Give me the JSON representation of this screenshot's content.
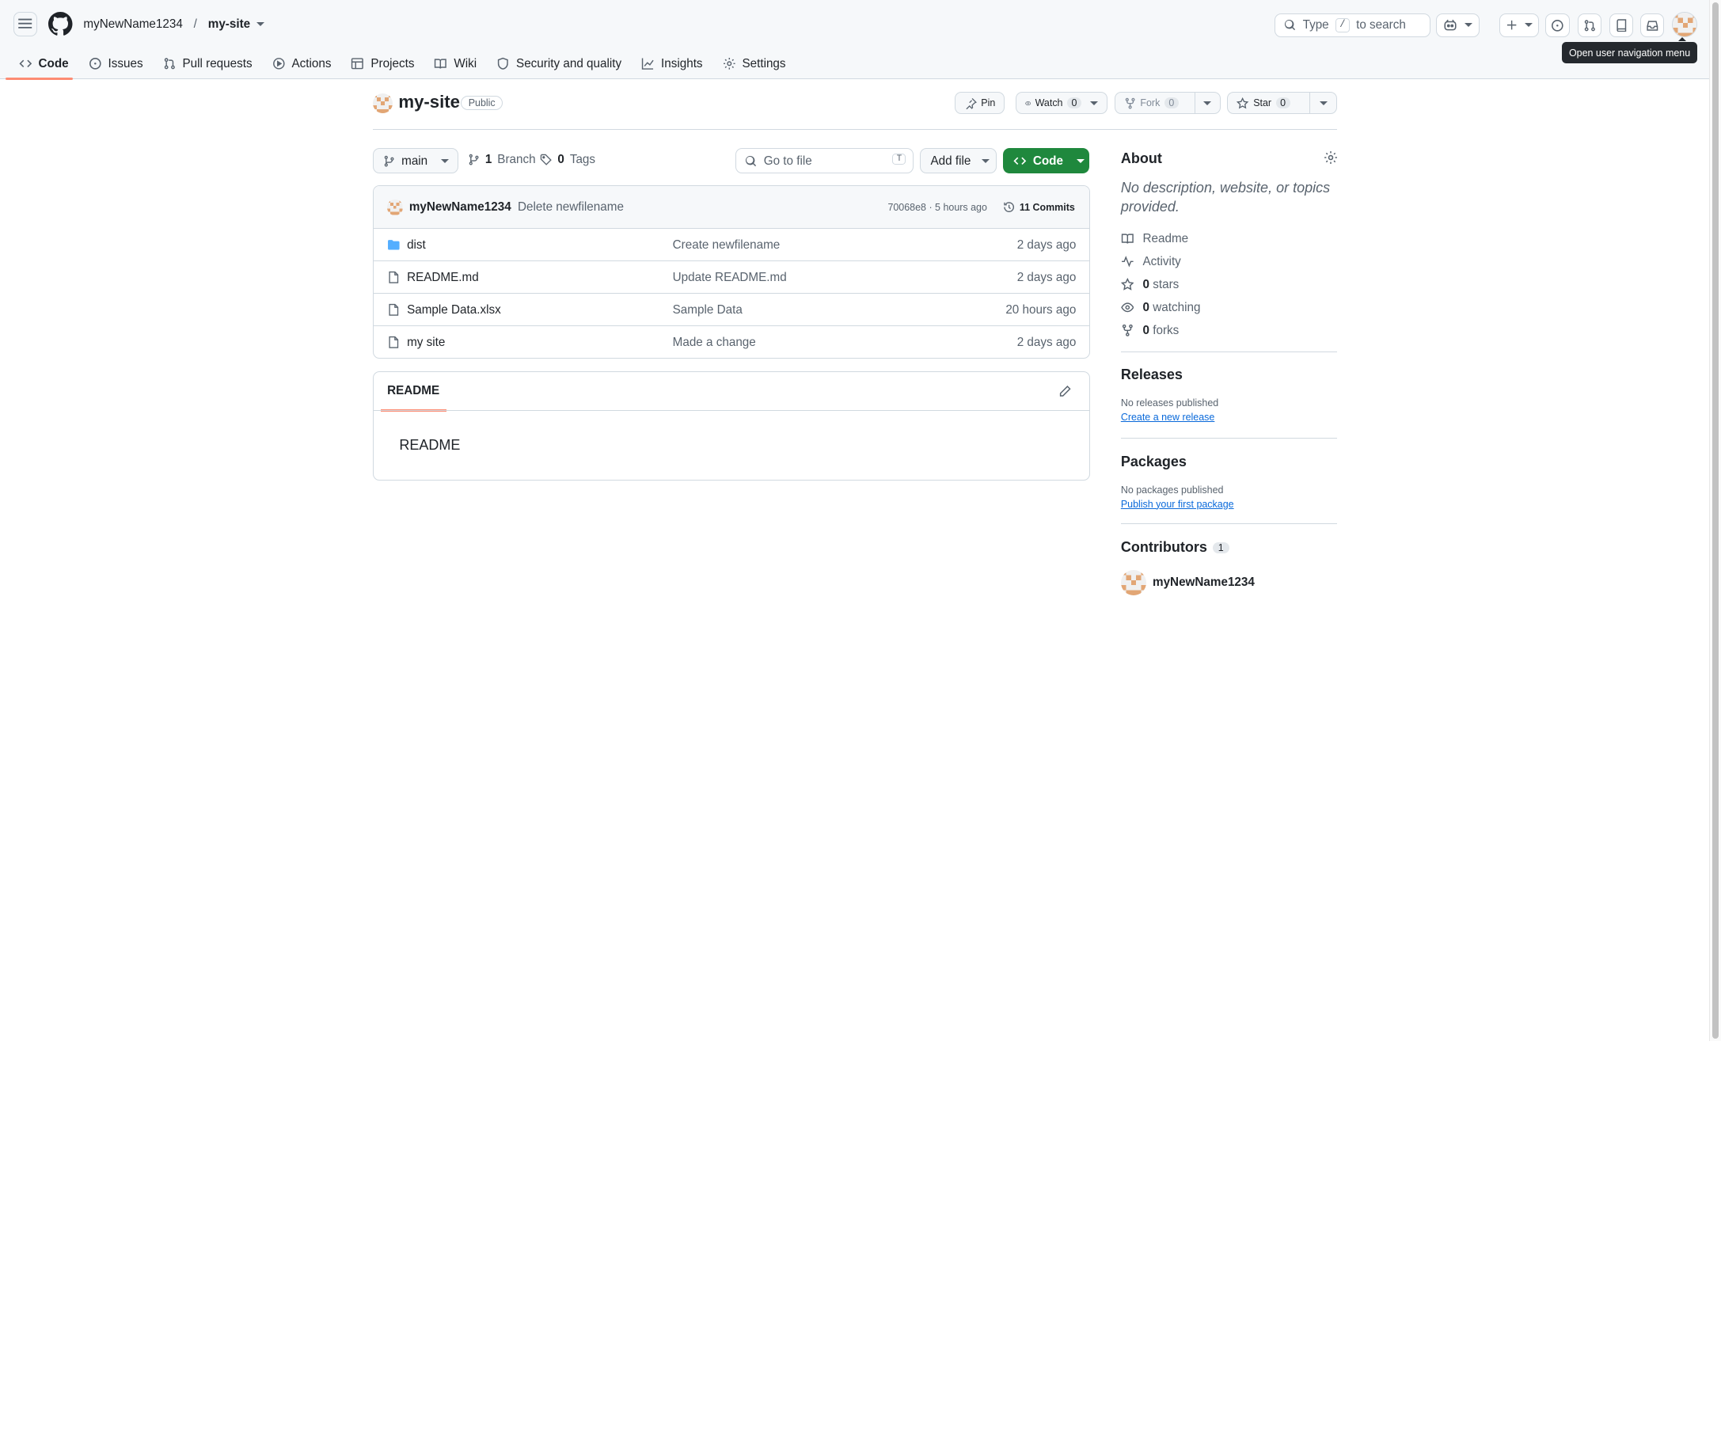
{
  "header": {
    "owner": "myNewName1234",
    "separator": "/",
    "repo": "my-site",
    "search_type": "Type",
    "search_key": "/",
    "search_rest": "to search",
    "tooltip": "Open user navigation menu"
  },
  "tabs": [
    {
      "label": "Code",
      "icon": "code-icon"
    },
    {
      "label": "Issues",
      "icon": "issue-icon"
    },
    {
      "label": "Pull requests",
      "icon": "pull-request-icon"
    },
    {
      "label": "Actions",
      "icon": "play-icon"
    },
    {
      "label": "Projects",
      "icon": "table-icon"
    },
    {
      "label": "Wiki",
      "icon": "book-icon"
    },
    {
      "label": "Security and quality",
      "icon": "shield-icon"
    },
    {
      "label": "Insights",
      "icon": "graph-icon"
    },
    {
      "label": "Settings",
      "icon": "gear-icon"
    }
  ],
  "repo": {
    "name": "my-site",
    "visibility": "Public",
    "pin_label": "Pin",
    "watch_label": "Watch",
    "watch_count": "0",
    "fork_label": "Fork",
    "fork_count": "0",
    "star_label": "Star",
    "star_count": "0"
  },
  "toolbar": {
    "branch": "main",
    "branches_count": "1",
    "branches_label": "Branch",
    "tags_count": "0",
    "tags_label": "Tags",
    "goto_placeholder": "Go to file",
    "goto_key": "T",
    "add_file_label": "Add file",
    "code_label": "Code"
  },
  "commit": {
    "author": "myNewName1234",
    "message": "Delete newfilename",
    "hash_time": "70068e8 · 5 hours ago",
    "commits_label": "11 Commits"
  },
  "files": [
    {
      "type": "folder",
      "name": "dist",
      "message": "Create newfilename",
      "age": "2 days ago"
    },
    {
      "type": "file",
      "name": "README.md",
      "message": "Update README.md",
      "age": "2 days ago"
    },
    {
      "type": "file",
      "name": "Sample Data.xlsx",
      "message": "Sample Data",
      "age": "20 hours ago"
    },
    {
      "type": "file",
      "name": "my site",
      "message": "Made a change",
      "age": "2 days ago"
    }
  ],
  "readme": {
    "tab_label": "README",
    "body": "README"
  },
  "about": {
    "heading": "About",
    "description": "No description, website, or topics provided.",
    "readme_label": "Readme",
    "activity_label": "Activity",
    "stars_count": "0",
    "stars_label": "stars",
    "watching_count": "0",
    "watching_label": "watching",
    "forks_count": "0",
    "forks_label": "forks"
  },
  "releases": {
    "heading": "Releases",
    "empty": "No releases published",
    "link": "Create a new release"
  },
  "packages": {
    "heading": "Packages",
    "empty": "No packages published",
    "link": "Publish your first package"
  },
  "contributors": {
    "heading": "Contributors",
    "count": "1",
    "items": [
      {
        "name": "myNewName1234"
      }
    ]
  },
  "colors": {
    "accent_green": "#1f883d",
    "link_blue": "#0969da",
    "active_tab_underline": "#fd8c73"
  }
}
